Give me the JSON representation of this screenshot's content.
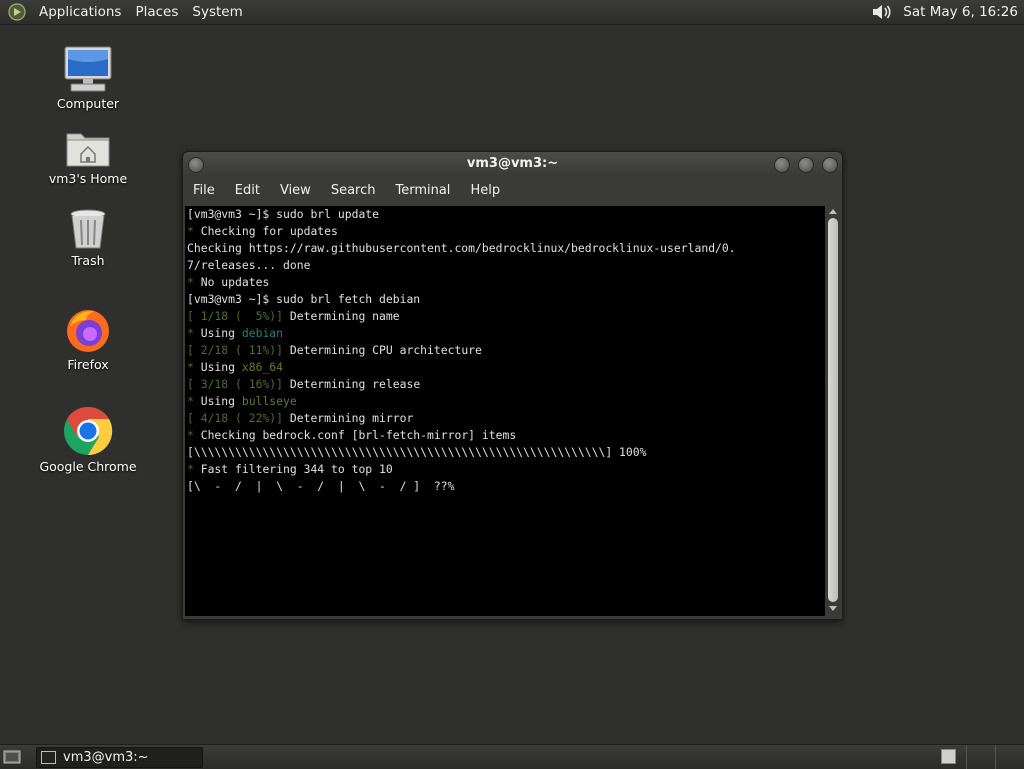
{
  "top_panel": {
    "menus": [
      "Applications",
      "Places",
      "System"
    ],
    "clock": "Sat May  6, 16:26"
  },
  "desktop": {
    "icons": [
      {
        "label": "Computer",
        "icon": "computer-icon"
      },
      {
        "label": "vm3's Home",
        "icon": "home-folder-icon"
      },
      {
        "label": "Trash",
        "icon": "trash-icon"
      },
      {
        "label": "Firefox",
        "icon": "firefox-icon"
      },
      {
        "label": "Google Chrome",
        "icon": "chrome-icon"
      }
    ]
  },
  "terminal": {
    "title": "vm3@vm3:~",
    "menu": [
      "File",
      "Edit",
      "View",
      "Search",
      "Terminal",
      "Help"
    ],
    "lines": [
      [
        {
          "t": "[vm3@vm3 ~]$ sudo brl update",
          "c": ""
        }
      ],
      [
        {
          "t": "* ",
          "c": "dim"
        },
        {
          "t": "Checking for updates",
          "c": ""
        }
      ],
      [
        {
          "t": "Checking https://raw.githubusercontent.com/bedrocklinux/bedrocklinux-userland/0.",
          "c": ""
        }
      ],
      [
        {
          "t": "7/releases... done",
          "c": ""
        }
      ],
      [
        {
          "t": "* ",
          "c": "dim"
        },
        {
          "t": "No updates",
          "c": ""
        }
      ],
      [
        {
          "t": "[vm3@vm3 ~]$ sudo brl fetch debian",
          "c": ""
        }
      ],
      [
        {
          "t": "[ 1/18 (  5%)]",
          "c": "dim"
        },
        {
          "t": " Determining name",
          "c": ""
        }
      ],
      [
        {
          "t": "* ",
          "c": "dim"
        },
        {
          "t": "Using ",
          "c": ""
        },
        {
          "t": "debian",
          "c": "cy"
        }
      ],
      [
        {
          "t": "[ 2/18 ( 11%)]",
          "c": "dim"
        },
        {
          "t": " Determining CPU architecture",
          "c": ""
        }
      ],
      [
        {
          "t": "* ",
          "c": "dim"
        },
        {
          "t": "Using ",
          "c": ""
        },
        {
          "t": "x86_64",
          "c": "ol"
        }
      ],
      [
        {
          "t": "[ 3/18 ( 16%)]",
          "c": "dim"
        },
        {
          "t": " Determining release",
          "c": ""
        }
      ],
      [
        {
          "t": "* ",
          "c": "dim"
        },
        {
          "t": "Using ",
          "c": ""
        },
        {
          "t": "bullseye",
          "c": "ol"
        }
      ],
      [
        {
          "t": "[ 4/18 ( 22%)]",
          "c": "dim"
        },
        {
          "t": " Determining mirror",
          "c": ""
        }
      ],
      [
        {
          "t": "* ",
          "c": "dim"
        },
        {
          "t": "Checking bedrock.conf [brl-fetch-mirror] items",
          "c": ""
        }
      ],
      [
        {
          "t": "[\\\\\\\\\\\\\\\\\\\\\\\\\\\\\\\\\\\\\\\\\\\\\\\\\\\\\\\\\\\\\\\\\\\\\\\\\\\\\\\\\\\\\\\\\\\\\\\\\\\\\\\\\\\\\\\\\\\\\\\\] 100%",
          "c": ""
        }
      ],
      [
        {
          "t": "* ",
          "c": "dim"
        },
        {
          "t": "Fast filtering 344 to top 10",
          "c": ""
        }
      ],
      [
        {
          "t": "[\\  -  /  |  \\  -  /  |  \\  -  / ]  ??%",
          "c": ""
        }
      ]
    ]
  },
  "taskbar": {
    "task_label": "vm3@vm3:~"
  }
}
